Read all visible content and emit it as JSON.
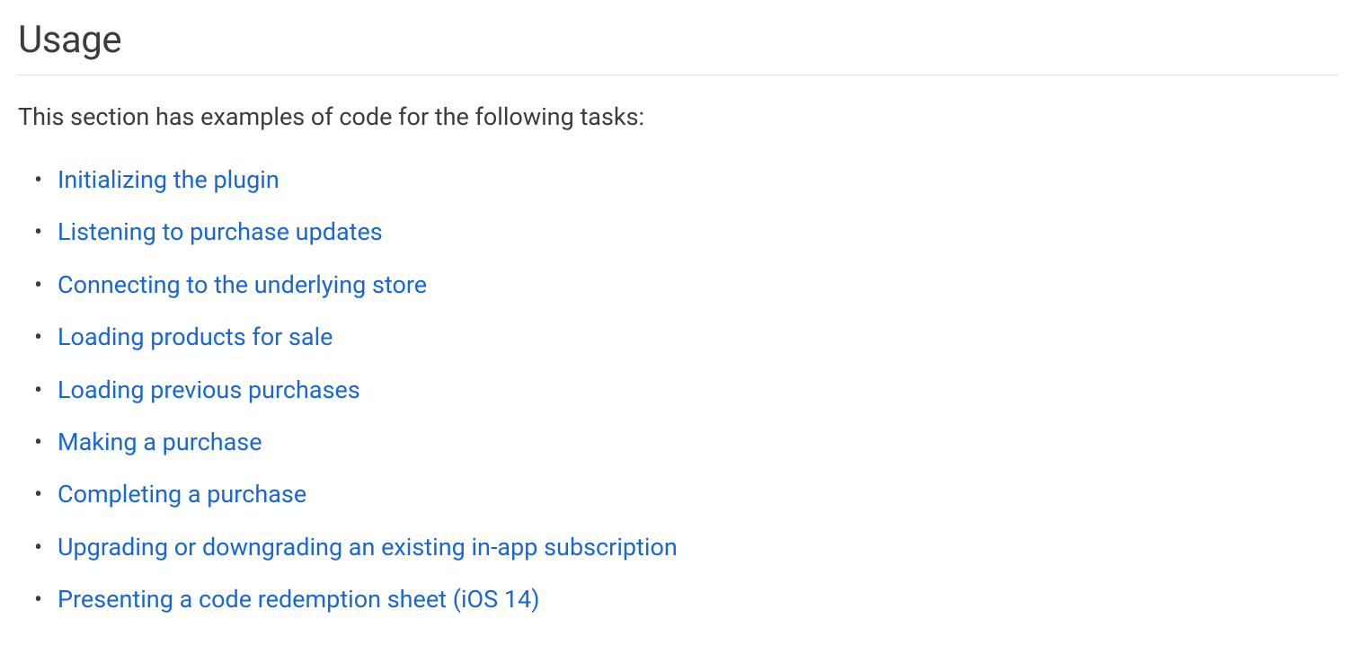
{
  "heading": "Usage",
  "intro": "This section has examples of code for the following tasks:",
  "links": [
    "Initializing the plugin",
    "Listening to purchase updates",
    "Connecting to the underlying store",
    "Loading products for sale",
    "Loading previous purchases",
    "Making a purchase",
    "Completing a purchase",
    "Upgrading or downgrading an existing in-app subscription",
    "Presenting a code redemption sheet (iOS 14)"
  ]
}
